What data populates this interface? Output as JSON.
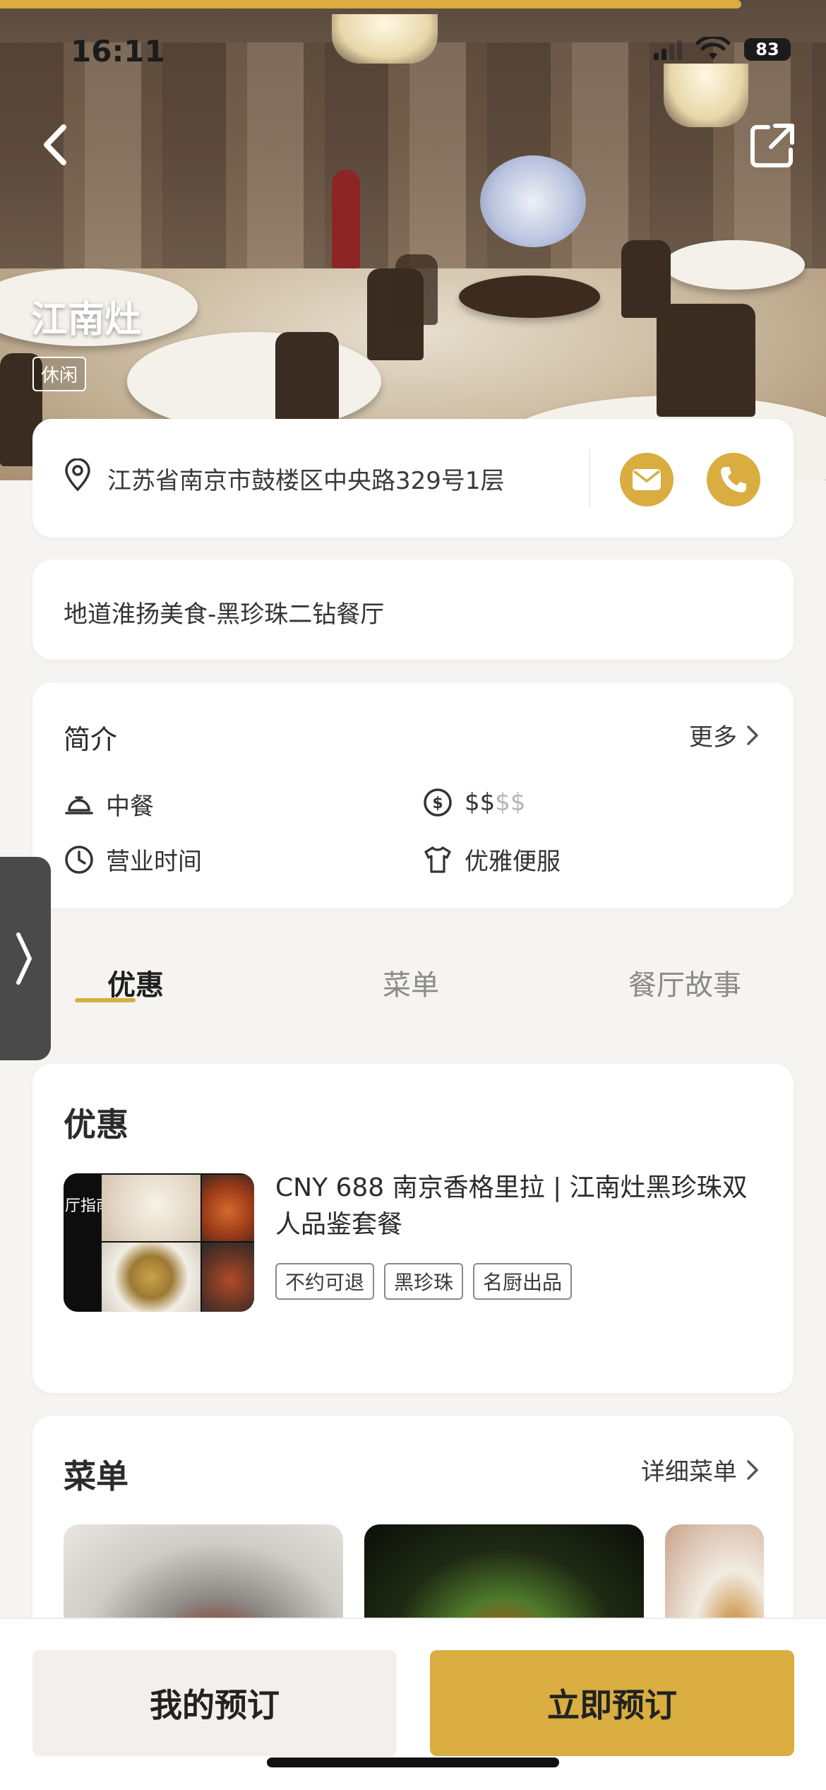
{
  "status": {
    "time": "16:11",
    "battery": "83"
  },
  "restaurant": {
    "name": "江南灶",
    "tag": "休闲"
  },
  "address": {
    "text": "江苏省南京市鼓楼区中央路329号1层"
  },
  "description": "地道淮扬美食-黑珍珠二钻餐厅",
  "intro": {
    "title": "简介",
    "more_label": "更多",
    "cuisine": "中餐",
    "price_active": "$$",
    "price_inactive": "$$",
    "hours_label": "营业时间",
    "dress_code": "优雅便服"
  },
  "tabs": [
    {
      "label": "优惠"
    },
    {
      "label": "菜单"
    },
    {
      "label": "餐厅故事"
    }
  ],
  "offers": {
    "title": "优惠",
    "item": {
      "name": "CNY 688 南京香格里拉 | 江南灶黑珍珠双人品鉴套餐",
      "thumb_text": "厅指南",
      "chips": [
        "不约可退",
        "黑珍珠",
        "名厨出品"
      ]
    }
  },
  "menu": {
    "title": "菜单",
    "detail_label": "详细菜单"
  },
  "bottom": {
    "my_booking": "我的预订",
    "book_now": "立即预订"
  },
  "colors": {
    "accent": "#d9ad3f",
    "background": "#f5f4f2"
  }
}
